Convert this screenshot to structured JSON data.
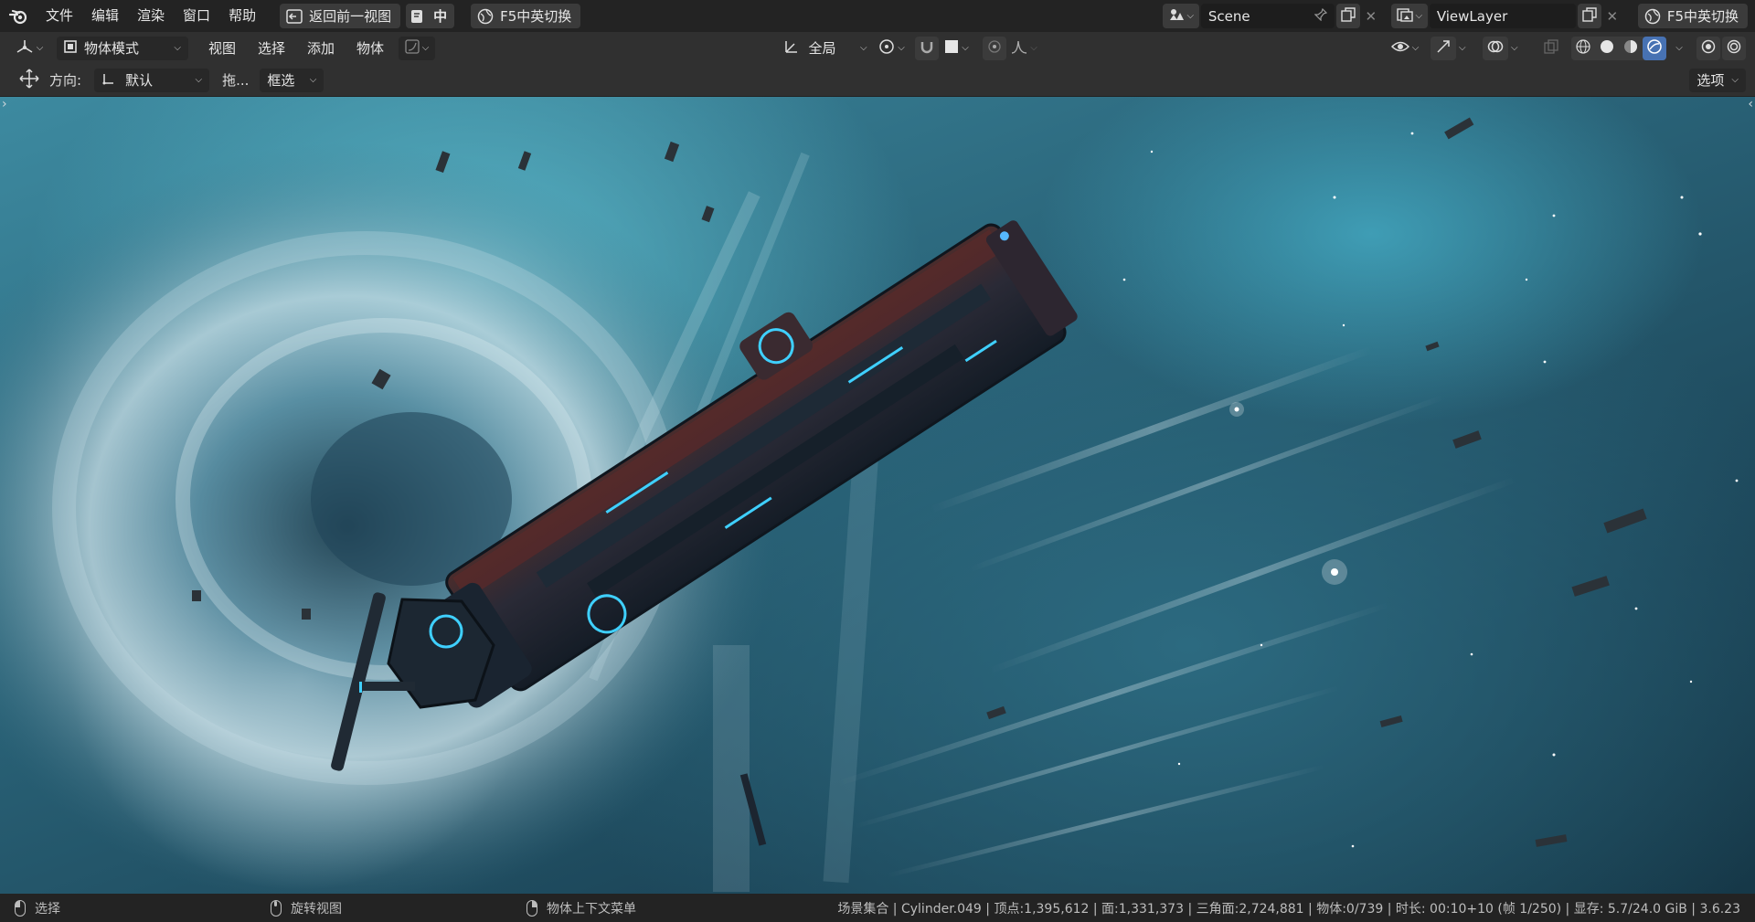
{
  "topbar": {
    "menu": [
      "文件",
      "编辑",
      "渲染",
      "窗口",
      "帮助"
    ],
    "back_button": "返回前一视图",
    "lang_toggle": "中",
    "f5_button": "F5中英切换",
    "scene_name": "Scene",
    "view_layer": "ViewLayer",
    "f5_button_right": "F5中英切换"
  },
  "header": {
    "mode": "物体模式",
    "menus": [
      "视图",
      "选择",
      "添加",
      "物体"
    ],
    "transform_orientation": "全局",
    "shading_mode": "rendered"
  },
  "tool_settings": {
    "orientation_label": "方向:",
    "orientation_value": "默认",
    "drag_label": "拖...",
    "drag_value": "框选",
    "options_label": "选项"
  },
  "statusbar": {
    "left_click": "选择",
    "middle_click": "旋转视图",
    "right_click": "物体上下文菜单",
    "stats": "场景集合 | Cylinder.049 | 顶点:1,395,612 | 面:1,331,373 | 三角面:2,724,881 | 物体:0/739 | 时长: 00:10+10 (帧 1/250) | 显存: 5.7/24.0 GiB | 3.6.23"
  },
  "colors": {
    "accent_active": "#4772b3",
    "ship_glow": "#3fd0ff"
  }
}
